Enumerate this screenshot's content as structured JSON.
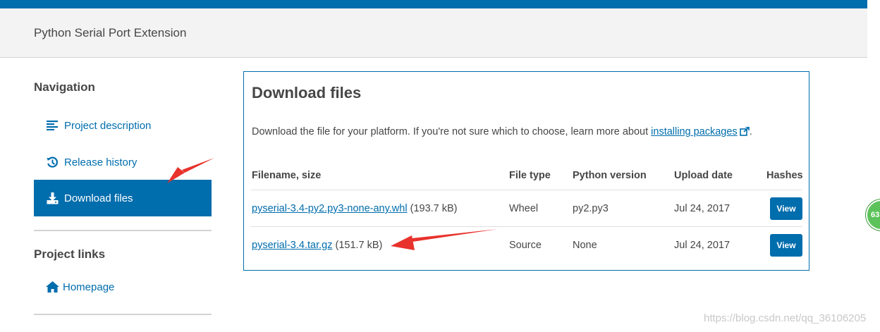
{
  "header": {
    "summary": "Python Serial Port Extension"
  },
  "sidebar": {
    "navigation_title": "Navigation",
    "items": [
      {
        "label": "Project description",
        "icon": "align-left-icon"
      },
      {
        "label": "Release history",
        "icon": "history-icon"
      },
      {
        "label": "Download files",
        "icon": "download-icon",
        "active": true
      }
    ],
    "links_title": "Project links",
    "links": [
      {
        "label": "Homepage",
        "icon": "home-icon"
      }
    ]
  },
  "panel": {
    "title": "Download files",
    "intro_text": "Download the file for your platform. If you're not sure which to choose, learn more about ",
    "intro_link": "installing packages",
    "intro_end": ".",
    "columns": [
      "Filename, size",
      "File type",
      "Python version",
      "Upload date",
      "Hashes"
    ],
    "rows": [
      {
        "filename": "pyserial-3.4-py2.py3-none-any.whl",
        "size": "(193.7 kB)",
        "type": "Wheel",
        "python": "py2.py3",
        "date": "Jul 24, 2017",
        "hash_button": "View"
      },
      {
        "filename": "pyserial-3.4.tar.gz",
        "size": "(151.7 kB)",
        "type": "Source",
        "python": "None",
        "date": "Jul 24, 2017",
        "hash_button": "View"
      }
    ]
  },
  "badge": {
    "text": "63"
  },
  "watermark": "https://blog.csdn.net/qq_36106205",
  "colors": {
    "primary": "#006dad",
    "annotation": "#e8322c",
    "badge": "#5cc35a"
  }
}
